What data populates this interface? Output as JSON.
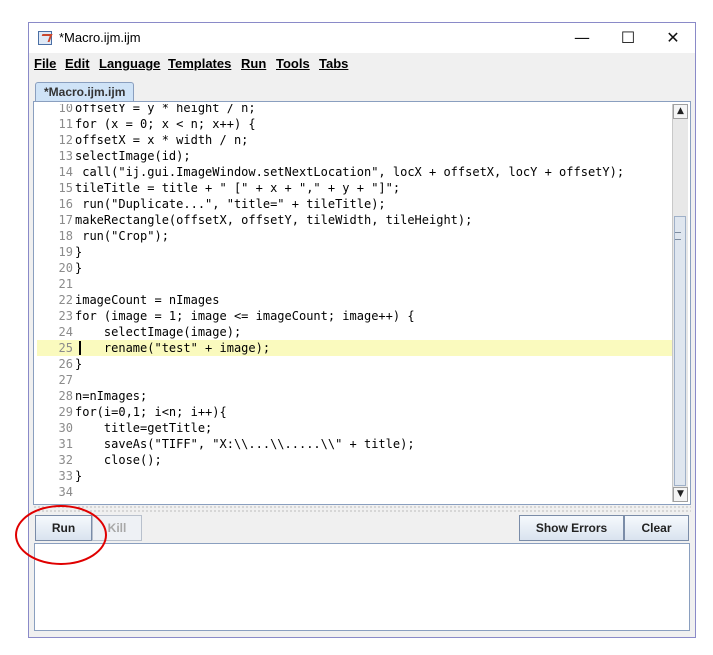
{
  "window": {
    "title": "*Macro.ijm.ijm",
    "minimize_label": "—",
    "maximize_label": "☐",
    "close_label": "✕"
  },
  "menu": {
    "items": [
      "File",
      "Edit",
      "Language",
      "Templates",
      "Run",
      "Tools",
      "Tabs"
    ]
  },
  "tab": {
    "label": "*Macro.ijm.ijm"
  },
  "editor": {
    "lines": [
      {
        "n": "10",
        "text": "offsetY = y * height / n;",
        "color": "#000000"
      },
      {
        "n": "11",
        "text": "for (x = 0; x < n; x++) {",
        "color": "#000000"
      },
      {
        "n": "12",
        "text": "offsetX = x * width / n;",
        "color": "#000000"
      },
      {
        "n": "13",
        "text": "selectImage(id);",
        "color": "#000000"
      },
      {
        "n": "14",
        "text": " call(\"ij.gui.ImageWindow.setNextLocation\", locX + offsetX, locY + offsetY);",
        "color": "#000000"
      },
      {
        "n": "15",
        "text": "tileTitle = title + \" [\" + x + \",\" + y + \"]\";",
        "color": "#000000"
      },
      {
        "n": "16",
        "text": " run(\"Duplicate...\", \"title=\" + tileTitle);",
        "color": "#000000"
      },
      {
        "n": "17",
        "text": "makeRectangle(offsetX, offsetY, tileWidth, tileHeight);",
        "color": "#000000"
      },
      {
        "n": "18",
        "text": " run(\"Crop\");",
        "color": "#000000"
      },
      {
        "n": "19",
        "text": "}",
        "color": "#000000"
      },
      {
        "n": "20",
        "text": "}",
        "color": "#000000"
      },
      {
        "n": "21",
        "text": "",
        "color": "#000000"
      },
      {
        "n": "22",
        "text": "imageCount = nImages",
        "color": "#000000"
      },
      {
        "n": "23",
        "text": "for (image = 1; image <= imageCount; image++) {",
        "color": "#000000"
      },
      {
        "n": "24",
        "text": "    selectImage(image);",
        "color": "#000000"
      },
      {
        "n": "25",
        "text": "    rename(\"test\" + image);",
        "color": "#000000"
      },
      {
        "n": "26",
        "text": "}",
        "color": "#000000"
      },
      {
        "n": "27",
        "text": "",
        "color": "#000000"
      },
      {
        "n": "28",
        "text": "n=nImages;",
        "color": "#000000"
      },
      {
        "n": "29",
        "text": "for(i=0,1; i<n; i++){",
        "color": "#000000"
      },
      {
        "n": "30",
        "text": "    title=getTitle;",
        "color": "#000000"
      },
      {
        "n": "31",
        "text": "    saveAs(\"TIFF\", \"X:\\\\...\\\\.....\\\\\" + title);",
        "color": "#000000"
      },
      {
        "n": "32",
        "text": "    close();",
        "color": "#000000"
      },
      {
        "n": "33",
        "text": "}",
        "color": "#000000"
      },
      {
        "n": "34",
        "text": "",
        "color": "#000000"
      }
    ],
    "highlighted_line": "25",
    "scroll_up_label": "▲",
    "scroll_down_label": "▼"
  },
  "buttons": {
    "run": "Run",
    "kill": "Kill",
    "show_errors": "Show Errors",
    "clear": "Clear"
  },
  "colors": {
    "keyword": "#0000cc",
    "string": "#c000c0",
    "builtin": "#c000c0",
    "highlight": "#fafabe",
    "annotation": "#e00000"
  }
}
